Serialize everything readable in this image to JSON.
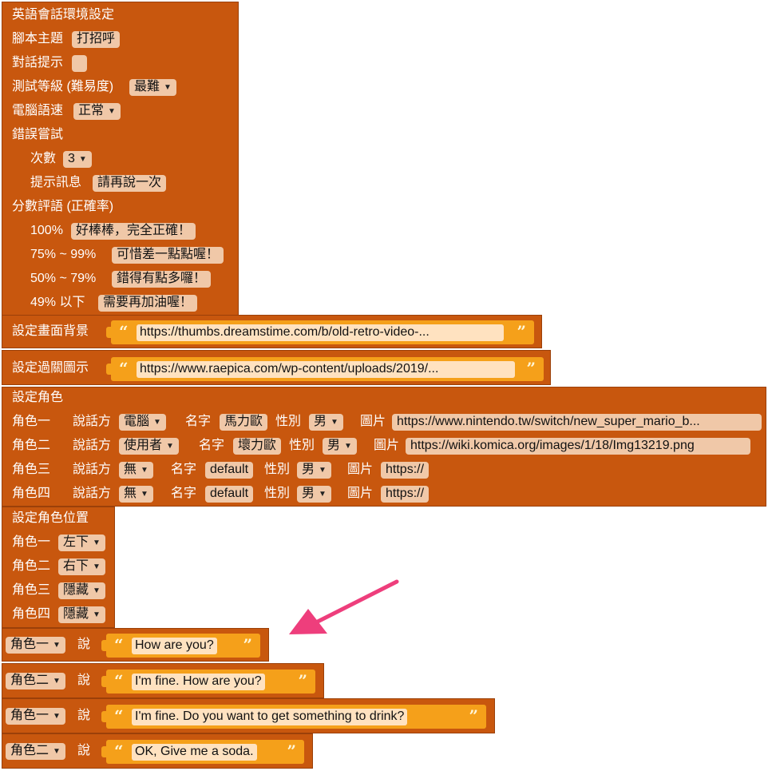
{
  "env": {
    "title": "英語會話環境設定",
    "script_label": "腳本主題",
    "script_value": "打招呼",
    "hint_label": "對話提示",
    "level_label": "測試等級 (難易度)",
    "level_value": "最難",
    "speed_label": "電腦語速",
    "speed_value": "正常",
    "retry_label": "錯誤嘗試",
    "count_label": "次數",
    "count_value": "3",
    "msg_label": "提示訊息",
    "msg_value": "請再說一次",
    "score_label": "分數評語 (正確率)",
    "scores": [
      {
        "range": "100%",
        "comment": "好棒棒，完全正確！"
      },
      {
        "range": "75% ~ 99%",
        "comment": "可惜差一點點喔！"
      },
      {
        "range": "50% ~ 79%",
        "comment": "錯得有點多囉！"
      },
      {
        "range": "49% 以下",
        "comment": "需要再加油喔！"
      }
    ]
  },
  "background": {
    "label": "設定畫面背景",
    "url": "https://thumbs.dreamstime.com/b/old-retro-video-..."
  },
  "pass_image": {
    "label": "設定過關圖示",
    "url": "https://www.raepica.com/wp-content/uploads/2019/..."
  },
  "roles": {
    "title": "設定角色",
    "speaker_label": "說話方",
    "name_label": "名字",
    "gender_label": "性別",
    "image_label": "圖片",
    "items": [
      {
        "role": "角色一",
        "speaker": "電腦",
        "name": "馬力歐",
        "gender": "男",
        "image": "https://www.nintendo.tw/switch/new_super_mario_b..."
      },
      {
        "role": "角色二",
        "speaker": "使用者",
        "name": "壞力歐",
        "gender": "男",
        "image": "https://wiki.komica.org/images/1/18/Img13219.png"
      },
      {
        "role": "角色三",
        "speaker": "無",
        "name": "default",
        "gender": "男",
        "image": "https://"
      },
      {
        "role": "角色四",
        "speaker": "無",
        "name": "default",
        "gender": "男",
        "image": "https://"
      }
    ]
  },
  "positions": {
    "title": "設定角色位置",
    "items": [
      {
        "role": "角色一",
        "pos": "左下"
      },
      {
        "role": "角色二",
        "pos": "右下"
      },
      {
        "role": "角色三",
        "pos": "隱藏"
      },
      {
        "role": "角色四",
        "pos": "隱藏"
      }
    ]
  },
  "says": [
    {
      "role": "角色一",
      "verb": "說",
      "text": "How are you?"
    },
    {
      "role": "角色二",
      "verb": "說",
      "text": "I'm fine. How are you?"
    },
    {
      "role": "角色一",
      "verb": "說",
      "text": "I'm fine. Do you want to get something to drink?"
    },
    {
      "role": "角色二",
      "verb": "說",
      "text": "OK, Give me a soda."
    }
  ],
  "symbols": {
    "open_quote": "“",
    "close_quote": "”",
    "dropdown_arrow": "▼"
  },
  "colors": {
    "block": "#c8570e",
    "field": "#f0c8a8",
    "string": "#f5a01a",
    "arrow": "#ee3e7c"
  }
}
